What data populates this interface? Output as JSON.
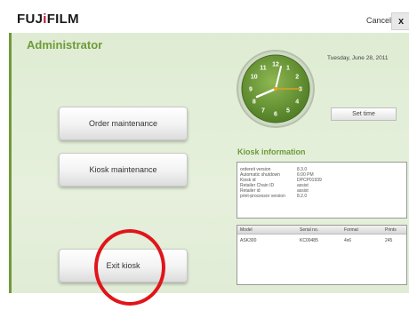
{
  "header": {
    "logo_prefix": "FUJ",
    "logo_accent": "i",
    "logo_suffix": "FILM",
    "cancel_label": "Cancel",
    "close_label": "x"
  },
  "page_title": "Administrator",
  "buttons": {
    "order_maintenance": "Order maintenance",
    "kiosk_maintenance": "Kiosk maintenance",
    "exit_kiosk": "Exit kiosk"
  },
  "clock": {
    "numbers": [
      "12",
      "1",
      "2",
      "3",
      "4",
      "5",
      "6",
      "7",
      "8",
      "9",
      "10",
      "11"
    ]
  },
  "date": "Tuesday, June 28, 2011",
  "set_time_label": "Set time",
  "kiosk_info": {
    "title": "Kiosk information",
    "rows": [
      {
        "label": "ordereit version",
        "value": "8.3.0"
      },
      {
        "label": "Automatic shutdown",
        "value": "6:00 PM"
      },
      {
        "label": "Kiosk id",
        "value": "DPCP01939"
      },
      {
        "label": "Retailer Chain ID",
        "value": "assist"
      },
      {
        "label": "Retailer id",
        "value": "assist"
      },
      {
        "label": "print-processor version",
        "value": "8.2.0"
      }
    ]
  },
  "printers": {
    "columns": [
      "Model",
      "Serial no.",
      "Format",
      "Prints"
    ],
    "rows": [
      [
        "ASK300",
        "KC00485",
        "4x6",
        "245"
      ]
    ]
  },
  "colors": {
    "brand_red": "#c8102e",
    "accent_green": "#6e9b3a",
    "panel_bg": "#e2edd8",
    "highlight_circle": "#e0151b"
  }
}
